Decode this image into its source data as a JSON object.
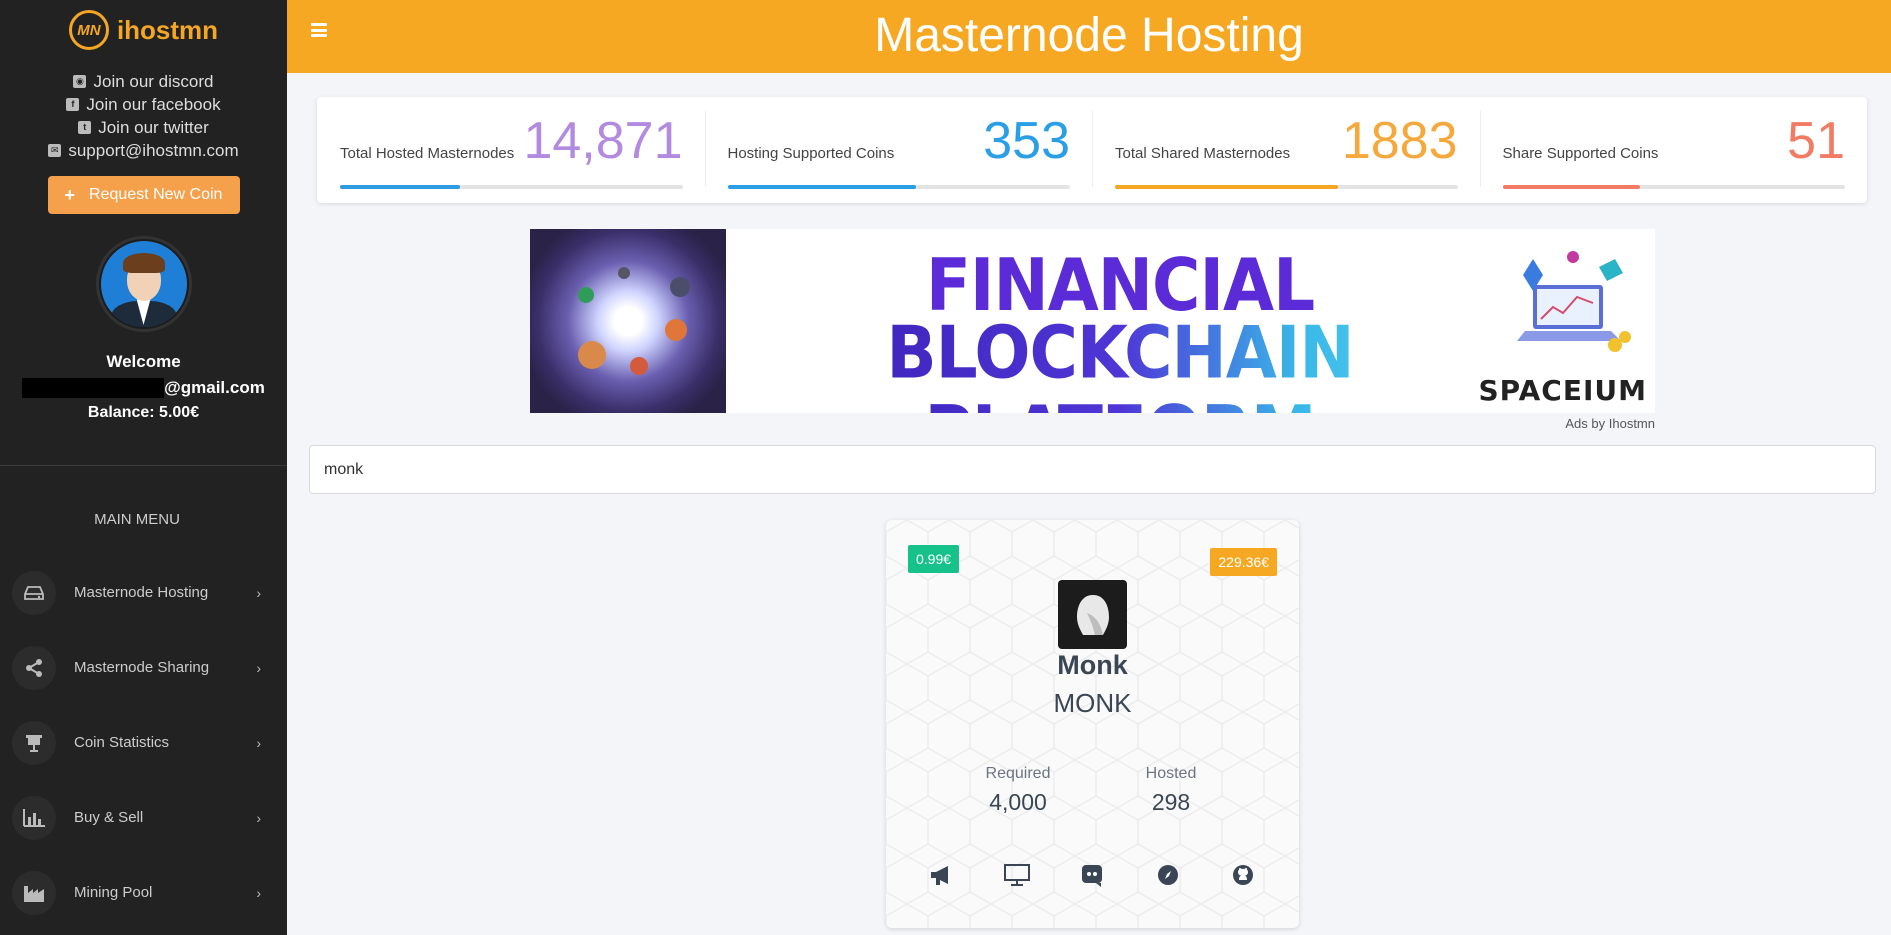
{
  "brand": {
    "name": "ihostmn",
    "logo_text": "MN"
  },
  "sidebar": {
    "social": [
      {
        "icon": "discord-icon",
        "label": "Join our discord"
      },
      {
        "icon": "facebook-icon",
        "label": "Join our facebook"
      },
      {
        "icon": "twitter-icon",
        "label": "Join our twitter"
      },
      {
        "icon": "envelope-icon",
        "label": "support@ihostmn.com"
      }
    ],
    "request_button": "Request New Coin",
    "welcome": "Welcome",
    "email_suffix": "@gmail.com",
    "balance": "Balance: 5.00€",
    "menu_title": "MAIN MENU",
    "menu": [
      {
        "icon": "hard-drive-icon",
        "label": "Masternode Hosting"
      },
      {
        "icon": "share-icon",
        "label": "Masternode Sharing"
      },
      {
        "icon": "presentation-icon",
        "label": "Coin Statistics"
      },
      {
        "icon": "bar-chart-icon",
        "label": "Buy & Sell"
      },
      {
        "icon": "factory-icon",
        "label": "Mining Pool"
      }
    ]
  },
  "header": {
    "title": "Masternode Hosting"
  },
  "stats": [
    {
      "label": "Total Hosted Masternodes",
      "value": "14,871",
      "color": "#b28ae0",
      "bar_color": "#2f9be0",
      "progress": 0.35
    },
    {
      "label": "Hosting Supported Coins",
      "value": "353",
      "color": "#2b9fe6",
      "bar_color": "#2b9fe6",
      "progress": 0.55
    },
    {
      "label": "Total Shared Masternodes",
      "value": "1883",
      "color": "#f5a83c",
      "bar_color": "#f5a623",
      "progress": 0.65
    },
    {
      "label": "Share Supported Coins",
      "value": "51",
      "color": "#f27b63",
      "bar_color": "#f27b63",
      "progress": 0.4
    }
  ],
  "ad": {
    "line1": "FINANCIAL",
    "line2": "BLOCKCHAIN PLATFORM",
    "brand": "SPACEIUM",
    "credit": "Ads by Ihostmn"
  },
  "search": {
    "value": "monk"
  },
  "coin": {
    "price_left": "0.99€",
    "price_right": "229.36€",
    "name": "Monk",
    "ticker": "MONK",
    "required_label": "Required",
    "required_value": "4,000",
    "hosted_label": "Hosted",
    "hosted_value": "298",
    "links": [
      "megaphone-icon",
      "monitor-icon",
      "discord-icon",
      "compass-icon",
      "github-icon"
    ]
  },
  "colors": {
    "accent": "#f7a823",
    "sidebar": "#222222",
    "success": "#17c28a"
  }
}
